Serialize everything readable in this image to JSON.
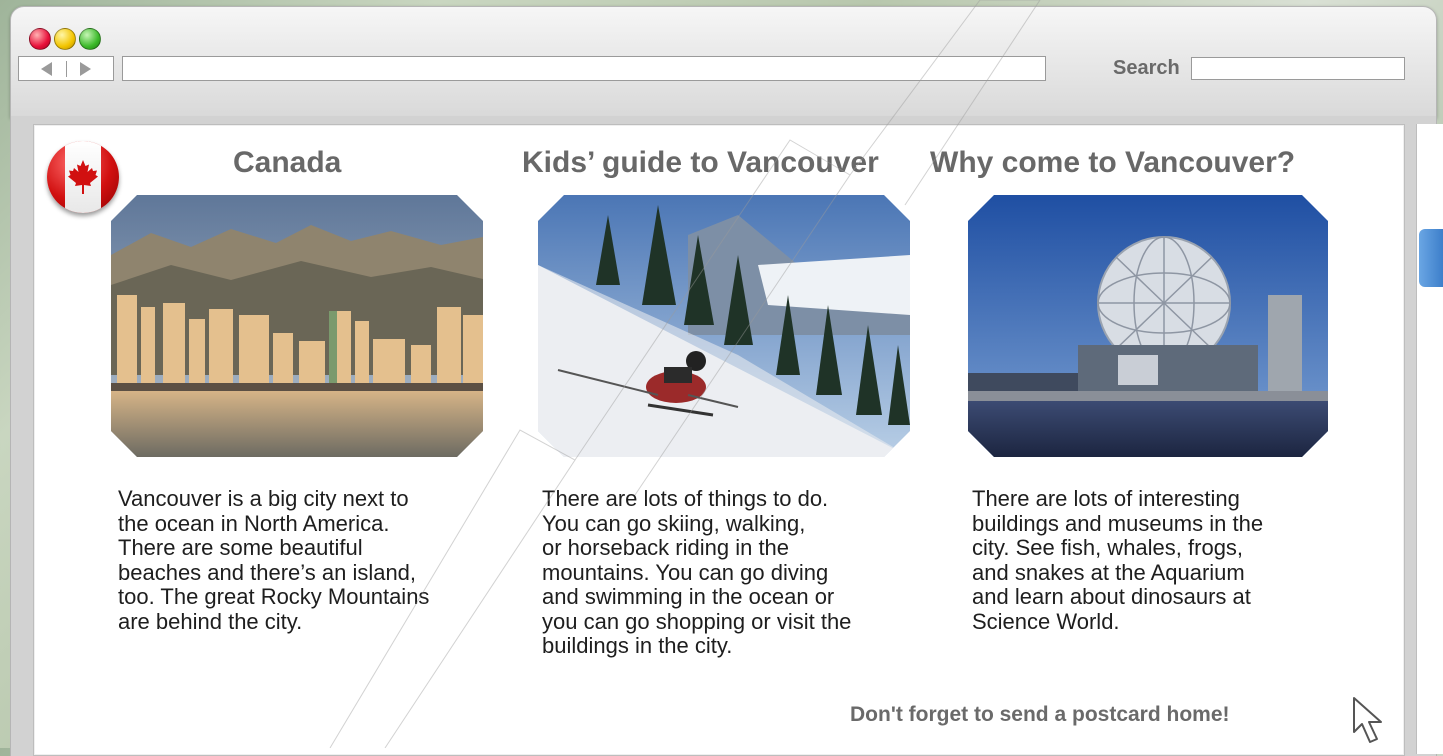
{
  "browser": {
    "nav": {
      "back_icon": "back-arrow-icon",
      "forward_icon": "forward-arrow-icon"
    },
    "address": {
      "value": ""
    },
    "search": {
      "label": "Search",
      "value": ""
    },
    "window_controls": {
      "close_color": "#e8103a",
      "minimize_color": "#f3c500",
      "maximize_color": "#3cba2a"
    }
  },
  "page": {
    "flag_icon": "canada-flag-icon",
    "columns": [
      {
        "title": "Canada",
        "photo": "vancouver-skyline-photo",
        "text_lines": [
          "Vancouver is a big city next to",
          "the ocean in North America.",
          "There are some beautiful",
          "beaches and there’s an island,",
          "too. The great Rocky Mountains",
          "are behind the city."
        ]
      },
      {
        "title": "Kids’ guide to Vancouver",
        "photo": "skier-photo",
        "text_lines": [
          "There are lots of things to do.",
          "You can go skiing, walking,",
          "or horseback riding in the",
          "mountains. You can go diving",
          "and swimming in the ocean or",
          "you can go shopping or visit the",
          "buildings in the city."
        ]
      },
      {
        "title": "Why come to Vancouver?",
        "photo": "science-world-photo",
        "text_lines": [
          "There are lots of interesting",
          "buildings and museums in the",
          "city. See fish, whales, frogs,",
          "and snakes at the Aquarium",
          "and learn about dinosaurs at",
          "Science World."
        ]
      }
    ],
    "footer_note": "Don't forget to send a postcard home!",
    "cursor_icon": "mouse-pointer-icon"
  },
  "colors": {
    "accent": "#3b7dc9",
    "title_gray": "#686868",
    "flag_red": "#d11010"
  }
}
